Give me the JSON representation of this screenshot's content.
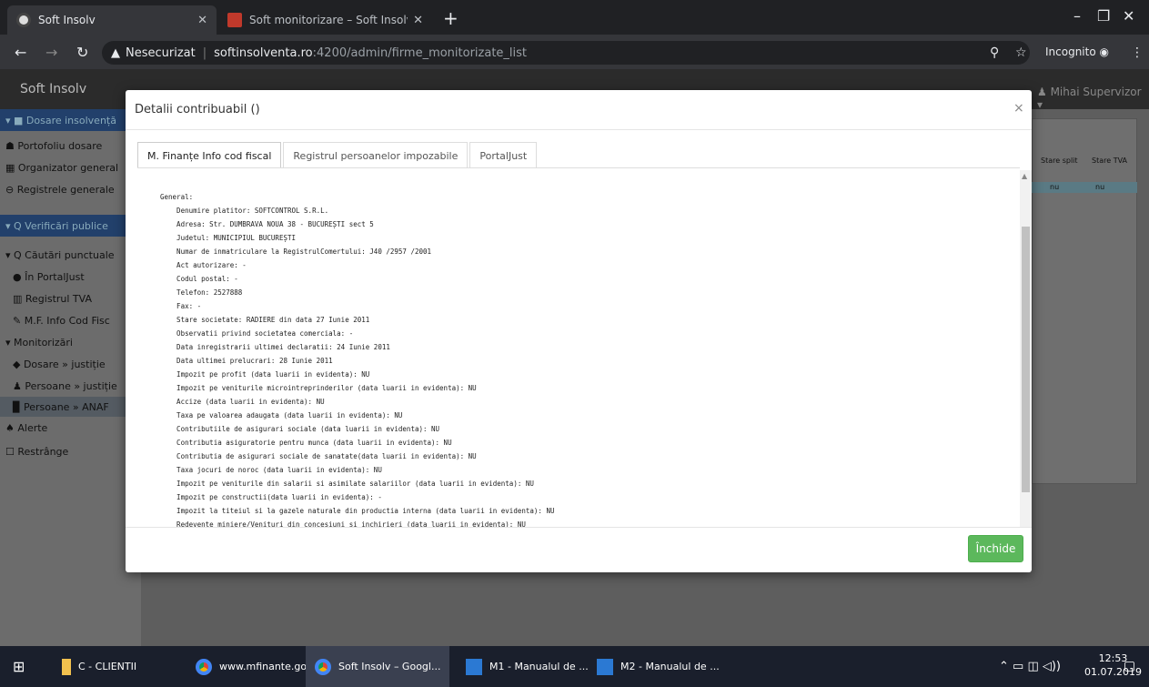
{
  "browser": {
    "tabs": [
      {
        "title": "Soft Insolv"
      },
      {
        "title": "Soft monitorizare – Soft Insolvent"
      }
    ],
    "url_prefix": "Nesecurizat",
    "url_host": "softinsolventa.ro",
    "url_path": ":4200/admin/firme_monitorizate_list",
    "incognito_label": "Incognito"
  },
  "app": {
    "brand": "Soft Insolv",
    "user": "Mihai Supervizor",
    "sidebar": [
      {
        "label": "▾ ■ Dosare insolvență"
      },
      {
        "label": "☗ Portofoliu dosare"
      },
      {
        "label": "▦ Organizator general"
      },
      {
        "label": "⊖ Registrele generale"
      },
      {
        "label": "▾ Q Verificări publice"
      },
      {
        "label": "▾ Q Căutări punctuale"
      },
      {
        "label": "● În PortalJust"
      },
      {
        "label": "▥ Registrul TVA"
      },
      {
        "label": "✎ M.F. Info Cod Fisc"
      },
      {
        "label": "▾ Monitorizări"
      },
      {
        "label": "◆ Dosare » justiție"
      },
      {
        "label": "♟ Persoane » justiție"
      },
      {
        "label": "▉ Persoane » ANAF"
      },
      {
        "label": "♠ Alerte"
      },
      {
        "label": "☐ Restrânge"
      }
    ],
    "table_headers": [
      "Stare split",
      "Stare TVA"
    ],
    "table_row": [
      "nu",
      "nu"
    ]
  },
  "modal": {
    "title": "Detalii contribuabil ()",
    "tabs": [
      "M. Finanțe Info cod fiscal",
      "Registrul persoanelor impozabile",
      "PortalJust"
    ],
    "lines": [
      "General:",
      "    Denumire platitor: SOFTCONTROL S.R.L.",
      "    Adresa: Str. DUMBRAVA NOUA 38 - BUCUREȘTI sect 5",
      "    Judetul: MUNICIPIUL BUCUREȘTI",
      "    Numar de inmatriculare la RegistrulComertului: J40 /2957 /2001",
      "    Act autorizare: -",
      "    Codul postal: -",
      "    Telefon: 2527888",
      "    Fax: -",
      "    Stare societate: RADIERE din data 27 Iunie 2011",
      "    Observatii privind societatea comerciala: -",
      "    Data inregistrarii ultimei declaratii: 24 Iunie 2011",
      "    Data ultimei prelucrari: 28 Iunie 2011",
      "    Impozit pe profit (data luarii in evidenta): NU",
      "    Impozit pe veniturile microintreprinderilor (data luarii in evidenta): NU",
      "    Accize (data luarii in evidenta): NU",
      "    Taxa pe valoarea adaugata (data luarii in evidenta): NU",
      "    Contributiile de asigurari sociale (data luarii in evidenta): NU",
      "    Contributia asiguratorie pentru munca (data luarii in evidenta): NU",
      "    Contributia de asigurari sociale de sanatate(data luarii in evidenta): NU",
      "    Taxa jocuri de noroc (data luarii in evidenta): NU",
      "    Impozit pe veniturile din salarii si asimilate salariilor (data luarii in evidenta): NU",
      "    Impozit pe constructii(data luarii in evidenta): -",
      "    Impozit la titeiul si la gazele naturale din productia interna (data luarii in evidenta): NU",
      "    Redevente miniere/Venituri din concesiuni si inchirieri (data luarii in evidenta): NU"
    ],
    "close_label": "Închide"
  },
  "taskbar": {
    "items": [
      {
        "label": "C - CLIENTII"
      },
      {
        "label": "www.mfinante.gov..."
      },
      {
        "label": "Soft Insolv – Googl..."
      },
      {
        "label": "M1 - Manualul de ..."
      },
      {
        "label": "M2 - Manualul de ..."
      }
    ],
    "time": "12:53",
    "date": "01.07.2019"
  }
}
